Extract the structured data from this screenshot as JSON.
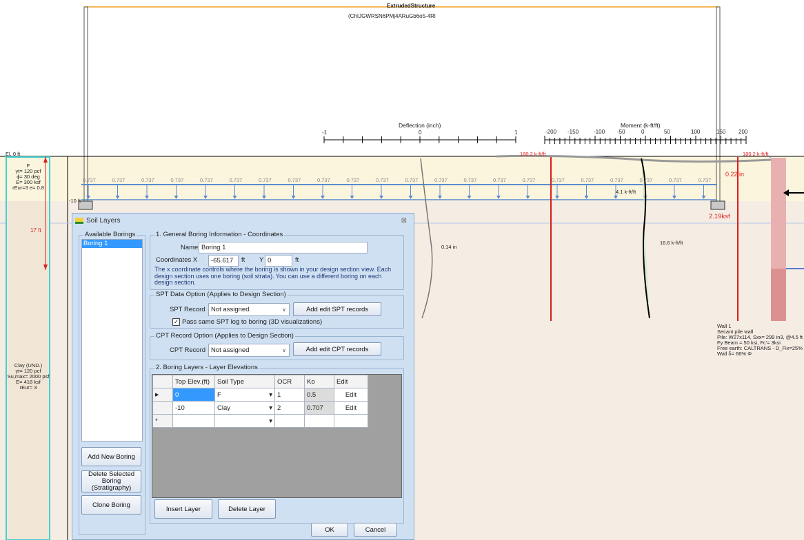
{
  "structure": {
    "title": "ExtrudedStructure",
    "id": "(ChIJGWRSN6PMj4ARuGb6o5-4Rl"
  },
  "deflection_axis": {
    "title": "Deflection (inch)",
    "ticks": [
      "-1",
      "0",
      "1"
    ]
  },
  "moment_axis": {
    "title": "Moment (k-ft/ft)",
    "ticks": [
      "-200",
      "-150",
      "-100",
      "-50",
      "0",
      "50",
      "100",
      "150",
      "200"
    ]
  },
  "elevation_label": "El. 0 ft",
  "moment_labels": {
    "left": "180.2 k-ft/ft",
    "right": "180.2 k-ft/ft",
    "mid": "16.6 k-ft/ft"
  },
  "load_value": "0.737",
  "load_marker": "4.1 k-ft/ft",
  "deflection_bottom": "0.14 in",
  "deflection_top": "0.22 in",
  "pressure": "2.19ksf",
  "wall_depth": "-10 ft",
  "embed_depth": "17 ft",
  "layer_F": {
    "lines": [
      "F",
      "γt= 120 pcf",
      "ϕ= 30 deg",
      "E= 300 ksf",
      "rEur=3 e= 0.8"
    ]
  },
  "layer_clay": {
    "lines": [
      "Clay (UND.)",
      "γt= 120 pcf",
      "Su,max= 2000 psf",
      "E= 418 ksf",
      "rEur= 3"
    ]
  },
  "wall_info": [
    "Wall 1",
    "Secant pile wall",
    "Pile: W27x114, Sxx= 299 in3, @4.5 ft",
    "Fy Beam = 50 ksi, Fc'= 3ksi",
    "Free earth: CALTRANS - D_Fix=25%",
    "Wall δ= 66% Φ"
  ],
  "dialog": {
    "title": "Soil Layers",
    "available_borings_label": "Available Borings",
    "borings": [
      "Boring 1"
    ],
    "add_new": "Add New Boring",
    "delete_selected": "Delete Selected Boring (Stratigraphy)",
    "clone": "Clone Boring",
    "general_label": "1. General Boring Information - Coordinates",
    "name_label": "Name",
    "name_value": "Boring 1",
    "coord_x_label": "Coordinates X",
    "coord_x_value": "-65.617",
    "unit_ft": "ft",
    "coord_y_label": "Y",
    "coord_y_value": "0",
    "info_text": "The x coordinate controls where the boring is shown in your design section view. Each design section uses one boring (soil strata). You can use a different boring on each design section.",
    "spt_group_label": "SPT Data Option (Applies to Design Section)",
    "spt_record_label": "SPT Record",
    "spt_record_value": "Not assigned",
    "spt_button": "Add edit SPT records",
    "spt_checkbox_label": "Pass same SPT log to boring (3D visualizations)",
    "cpt_group_label": "CPT Record Option (Applies to Design Section)",
    "cpt_record_label": "CPT Record",
    "cpt_record_value": "Not assigned",
    "cpt_button": "Add edit CPT records",
    "layers_label": "2. Boring Layers - Layer Elevations",
    "columns": [
      "Top Elev.(ft)",
      "Soil Type",
      "OCR",
      "Ko",
      "Edit"
    ],
    "rows": [
      {
        "top": "0",
        "soil": "F",
        "ocr": "1",
        "ko": "0.5",
        "edit": "Edit"
      },
      {
        "top": "-10",
        "soil": "Clay",
        "ocr": "2",
        "ko": "0.707",
        "edit": "Edit"
      }
    ],
    "insert_layer": "Insert Layer",
    "delete_layer": "Delete Layer",
    "ok": "OK",
    "cancel": "Cancel"
  }
}
